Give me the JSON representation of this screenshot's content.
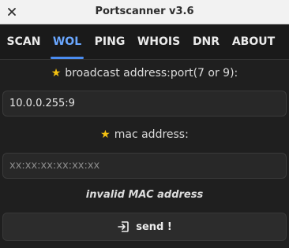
{
  "window": {
    "title": "Portscanner v3.6",
    "close_icon": "close-icon"
  },
  "tabs": [
    {
      "label": "SCAN",
      "active": false
    },
    {
      "label": "WOL",
      "active": true
    },
    {
      "label": "PING",
      "active": false
    },
    {
      "label": "WHOIS",
      "active": false
    },
    {
      "label": "DNR",
      "active": false
    },
    {
      "label": "ABOUT",
      "active": false
    }
  ],
  "form": {
    "broadcast_label": "broadcast address:port(7 or 9):",
    "broadcast_value": "10.0.0.255:9",
    "mac_label": "mac address:",
    "mac_placeholder": "xx:xx:xx:xx:xx:xx",
    "mac_value": "",
    "required_star": "★",
    "error_message": "invalid MAC address",
    "send_label": "send !",
    "send_icon": "login-arrow-icon"
  },
  "colors": {
    "accent": "#4a8cf0",
    "star": "#f5c211"
  }
}
